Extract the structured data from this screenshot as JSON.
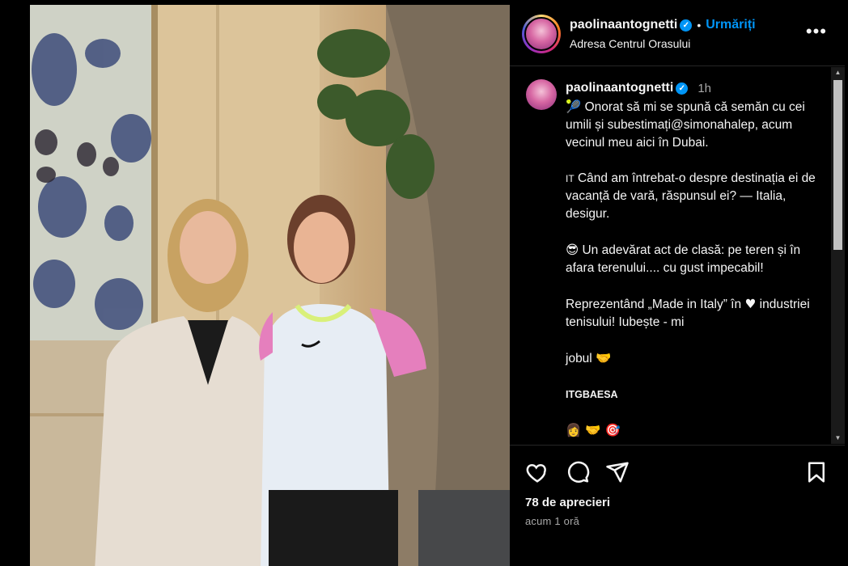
{
  "header": {
    "username": "paolinaantognetti",
    "follow_label": "Urmăriți",
    "location": "Adresa Centrul Orasului",
    "more_icon": "more-options-icon"
  },
  "caption": {
    "username": "paolinaantognetti",
    "time": "1h",
    "line1_emoji": "🎾",
    "line1": "Onorat să mi se spună că semăn cu cei umili și subestimați@simonahalep, acum vecinul meu aici în Dubai.",
    "line2_prefix": "IT",
    "line2": "Când am întrebat-o despre destinația ei de vacanță de vară, răspunsul ei? — Italia, desigur.",
    "line3_emoji": "😎",
    "line3": "Un adevărat act de clasă: pe teren și în afara terenului.... cu gust impecabil!",
    "line4a": "Reprezentând „Made in Italy” în",
    "line4_heart": "♥",
    "line4b": "industriei tenisului! Iubește - mi",
    "line5": "jobul",
    "line5_emoji": "🤝",
    "tag": "ITGBAESA",
    "last_emojis": "👩 🤝 🎯"
  },
  "stats": {
    "likes": "78 de aprecieri",
    "time_ago": "acum 1 oră"
  },
  "colors": {
    "accent": "#0095f6",
    "background": "#000000",
    "muted": "#a8a8a8"
  }
}
